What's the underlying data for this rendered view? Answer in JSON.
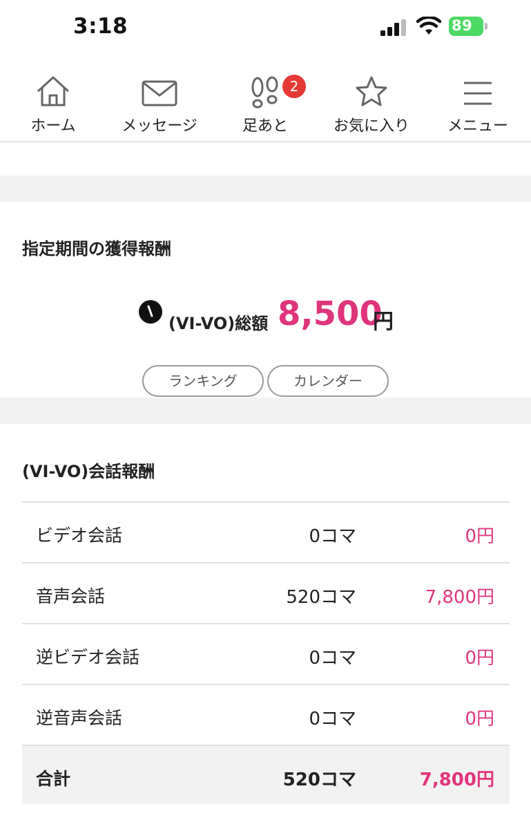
{
  "status_bar": {
    "time": "3:18",
    "battery": "89",
    "battery_color": "#4cd964"
  },
  "nav": {
    "items": [
      {
        "label": "ホーム",
        "icon": "home-icon"
      },
      {
        "label": "メッセージ",
        "icon": "mail-icon"
      },
      {
        "label": "足あと",
        "icon": "footprints-icon",
        "badge": "2"
      },
      {
        "label": "お気に入り",
        "icon": "star-icon"
      },
      {
        "label": "メニュー",
        "icon": "hamburger-menu-icon"
      }
    ]
  },
  "earnings": {
    "title": "指定期間の獲得報酬",
    "total_label": "(VI-VO)総額",
    "total_amount": "8,500",
    "total_unit": "円",
    "buttons": {
      "ranking": "ランキング",
      "calendar": "カレンダー"
    }
  },
  "conversation": {
    "title": "(VI-VO)会話報酬",
    "rows": [
      {
        "name": "ビデオ会話",
        "koma": "0コマ",
        "yen": "0円"
      },
      {
        "name": "音声会話",
        "koma": "520コマ",
        "yen": "7,800円"
      },
      {
        "name": "逆ビデオ会話",
        "koma": "0コマ",
        "yen": "0円"
      },
      {
        "name": "逆音声会話",
        "koma": "0コマ",
        "yen": "0円"
      }
    ],
    "total": {
      "name": "合計",
      "koma": "520コマ",
      "yen": "7,800円"
    }
  },
  "colors": {
    "accent": "#e0357d",
    "badge": "#e53935",
    "band": "#f2f2f2"
  }
}
